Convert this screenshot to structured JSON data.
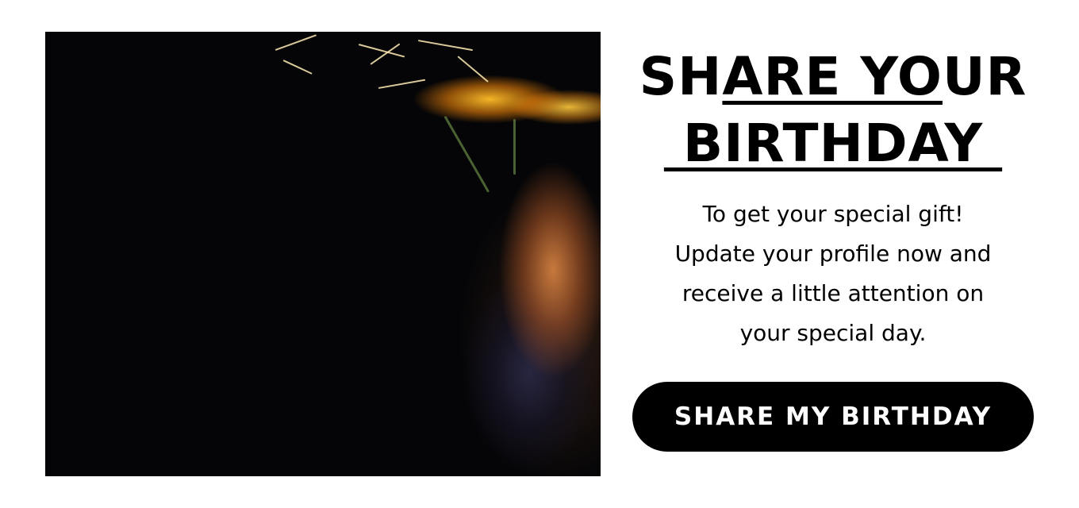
{
  "promo": {
    "title_line1_a": "SH",
    "title_line1_b": "ARE YO",
    "title_line1_c": "UR",
    "title_line2": " BIRTHDAY ",
    "body_lines": [
      "To get your special gift!",
      "Update your profile now and",
      "receive a little attention on",
      "your special day."
    ],
    "cta_label": "SHARE MY BIRTHDAY"
  },
  "colors": {
    "background": "#ffffff",
    "text": "#000000",
    "button_bg": "#000000",
    "button_text": "#ffffff"
  }
}
